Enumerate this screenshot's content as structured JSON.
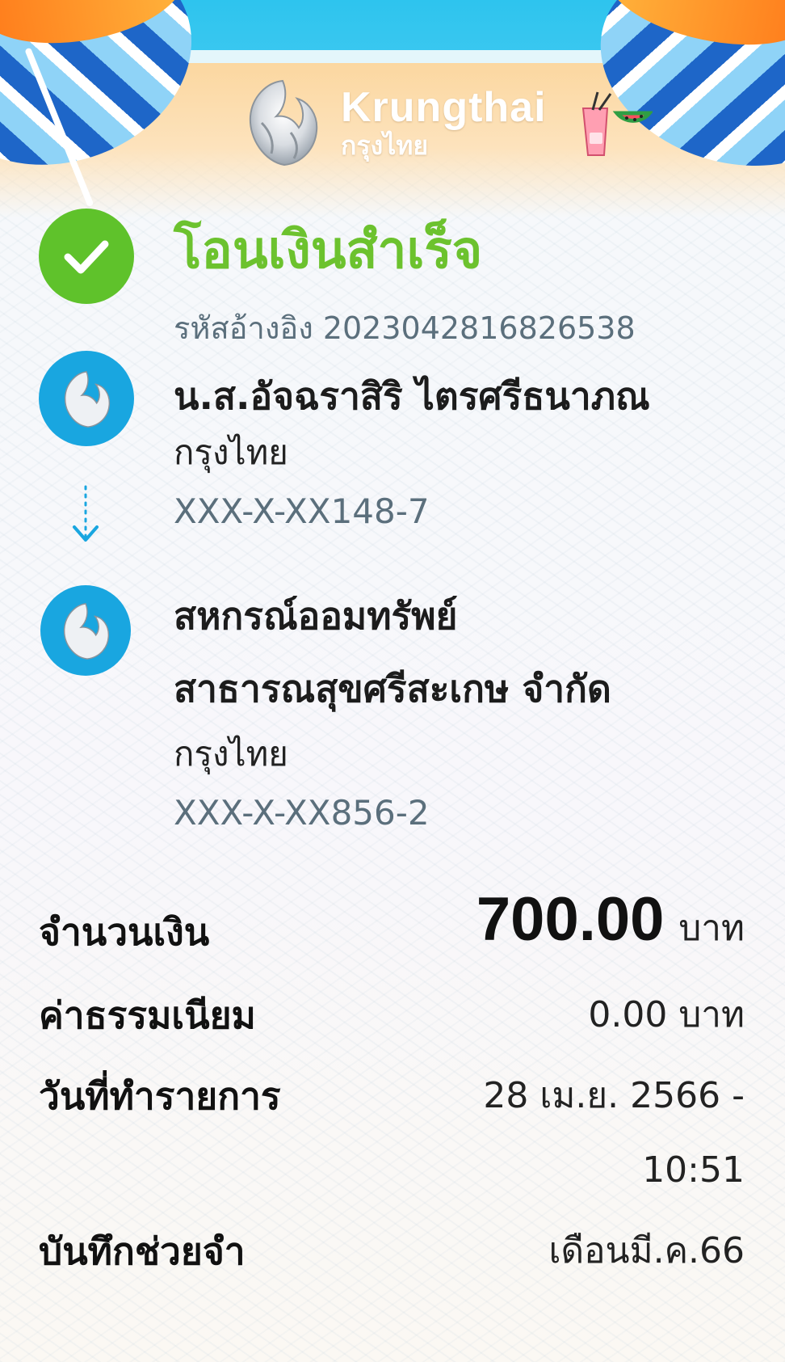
{
  "header": {
    "brand_en": "Krungthai",
    "brand_th": "กรุงไทย"
  },
  "status": {
    "title": "โอนเงินสำเร็จ",
    "reference": "รหัสอ้างอิง 2023042816826538"
  },
  "sender": {
    "name": "น.ส.อัจฉราสิริ ไตรศรีธนาภณ",
    "bank": "กรุงไทย",
    "account": "XXX-X-XX148-7"
  },
  "recipient": {
    "name_line1": "สหกรณ์ออมทรัพย์",
    "name_line2": "สาธารณสุขศรีสะเกษ จำกัด",
    "bank": "กรุงไทย",
    "account": "XXX-X-XX856-2"
  },
  "details": {
    "amount_label": "จำนวนเงิน",
    "amount_value": "700.00",
    "amount_unit": "บาท",
    "fee_label": "ค่าธรรมเนียม",
    "fee_value": "0.00 บาท",
    "date_label": "วันที่ทำรายการ",
    "date_value": "28 เม.ย. 2566 -",
    "time_value": "10:51",
    "memo_label": "บันทึกช่วยจำ",
    "memo_value": "เดือนมี.ค.66"
  },
  "colors": {
    "success_green": "#6cc22e",
    "bank_blue": "#19a6e0",
    "account_gray": "#5b6f7c"
  }
}
